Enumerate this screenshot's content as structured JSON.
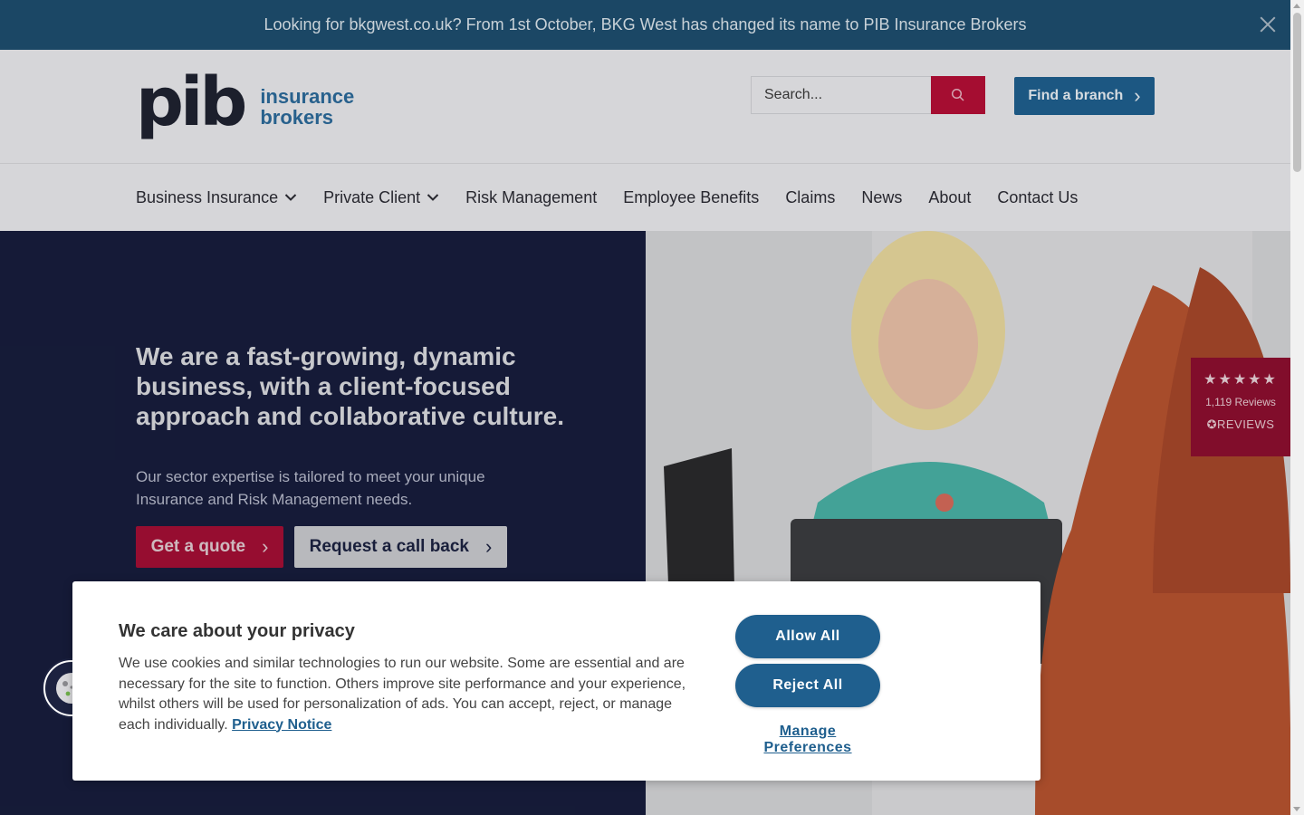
{
  "announcement": {
    "text": "Looking for bkgwest.co.uk? From 1st October, BKG West has changed its name to PIB Insurance Brokers",
    "close_icon": "close-icon"
  },
  "header": {
    "logo_mark": "pib",
    "logo_line1": "insurance",
    "logo_line2": "brokers",
    "search_placeholder": "Search...",
    "search_icon": "search-icon",
    "find_branch_label": "Find a branch"
  },
  "nav": {
    "items": [
      {
        "label": "Business Insurance",
        "has_dropdown": true
      },
      {
        "label": "Private Client",
        "has_dropdown": true
      },
      {
        "label": "Risk Management",
        "has_dropdown": false
      },
      {
        "label": "Employee Benefits",
        "has_dropdown": false
      },
      {
        "label": "Claims",
        "has_dropdown": false
      },
      {
        "label": "News",
        "has_dropdown": false
      },
      {
        "label": "About",
        "has_dropdown": false
      },
      {
        "label": "Contact Us",
        "has_dropdown": false
      }
    ]
  },
  "hero": {
    "title": "We are a fast-growing, dynamic business, with a client-focused approach and collaborative culture.",
    "subtitle": "Our sector expertise is tailored to meet your unique Insurance and Risk Management needs.",
    "quote_button": "Get a quote",
    "callback_button": "Request a call back"
  },
  "reviews": {
    "stars": "★★★★★",
    "rating_stars": 4.5,
    "count": "1,119 Reviews",
    "brand": "REVIEWS"
  },
  "cookie": {
    "title": "We care about your privacy",
    "body": "We use cookies and similar technologies to run our website. Some are essential and are necessary for the site to function. Others improve site performance and your experience, whilst others will be used for personalization of ads. You can accept, reject, or manage each individually.",
    "privacy_link": "Privacy Notice",
    "allow_all": "Allow All",
    "reject_all": "Reject All",
    "manage": "Manage Preferences"
  },
  "colors": {
    "announcement_bg": "#1e4e6e",
    "brand_blue": "#1f5f8e",
    "brand_red": "#b30f36",
    "hero_navy": "#171d3c"
  }
}
